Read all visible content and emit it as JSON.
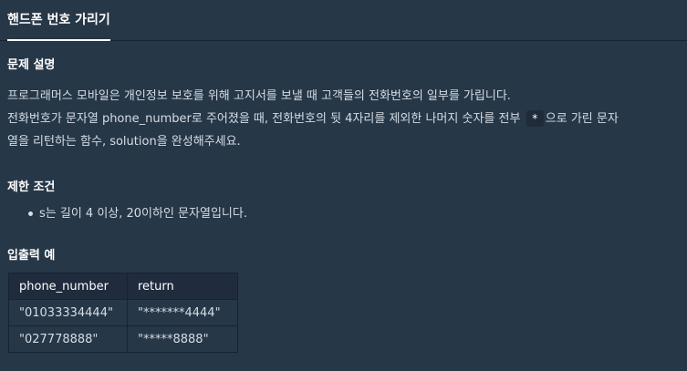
{
  "tab": {
    "title": "핸드폰 번호 가리기"
  },
  "problem": {
    "heading": "문제 설명",
    "line1": "프로그래머스 모바일은 개인정보 보호를 위해 고지서를 보낼 때 고객들의 전화번호의 일부를 가립니다.",
    "line2_before": "전화번호가 문자열 phone_number로 주어졌을 때, 전화번호의 뒷 4자리를 제외한 나머지 숫자를 전부",
    "line2_code": "*",
    "line2_after": "으로 가린 문자",
    "line3": "열을 리턴하는 함수, solution을 완성해주세요."
  },
  "constraints": {
    "heading": "제한 조건",
    "items": [
      "s는 길이 4 이상, 20이하인 문자열입니다."
    ]
  },
  "examples": {
    "heading": "입출력 예",
    "headers": [
      "phone_number",
      "return"
    ],
    "rows": [
      [
        "\"01033334444\"",
        "\"*******4444\""
      ],
      [
        "\"027778888\"",
        "\"*****8888\""
      ]
    ]
  }
}
